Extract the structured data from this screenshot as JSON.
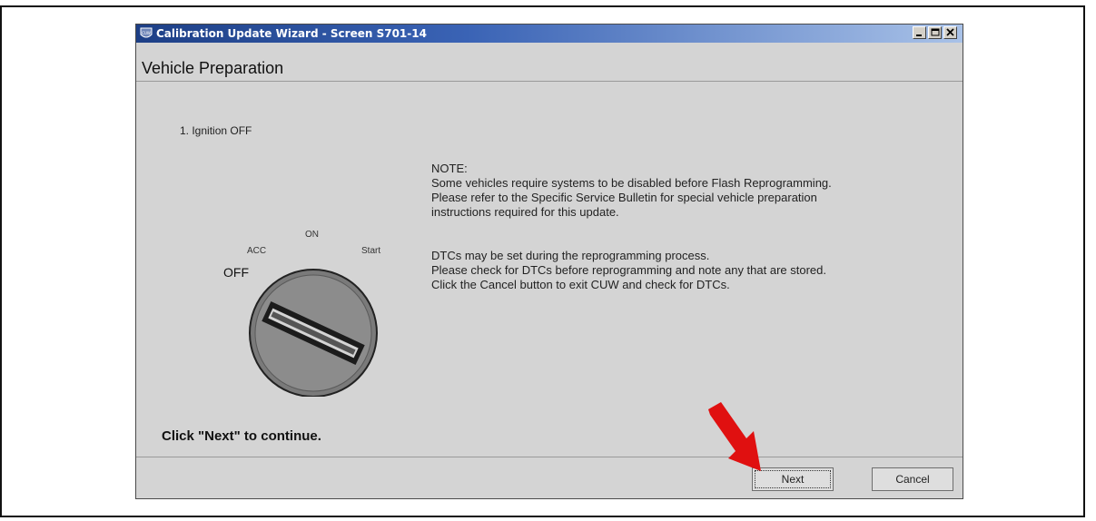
{
  "window": {
    "title": "Calibration Update Wizard - Screen S701-14",
    "app_icon_text": "CUW"
  },
  "header": {
    "heading": "Vehicle Preparation"
  },
  "main": {
    "step": "1. Ignition OFF",
    "key_positions": {
      "off": "OFF",
      "acc": "ACC",
      "on": "ON",
      "start": "Start"
    },
    "note_lines": [
      "NOTE:",
      "Some vehicles require systems to be disabled before Flash Reprogramming.",
      "Please refer to the Specific Service Bulletin for special vehicle preparation",
      "instructions required for this update."
    ],
    "dtc_lines": [
      "DTCs may be set during the reprogramming process.",
      "Please check for DTCs before reprogramming and note any that are stored.",
      "Click the Cancel button to exit CUW and check for DTCs."
    ],
    "continue_text": "Click \"Next\" to continue."
  },
  "buttons": {
    "next_label": "Next",
    "cancel_label": "Cancel"
  },
  "colors": {
    "titlebar": "#1d3f86",
    "window_bg": "#d4d4d4",
    "arrow": "#e01010"
  },
  "icons": {
    "window_controls": [
      "minimize-icon",
      "maximize-icon",
      "close-icon"
    ],
    "callout": "arrow-icon"
  }
}
